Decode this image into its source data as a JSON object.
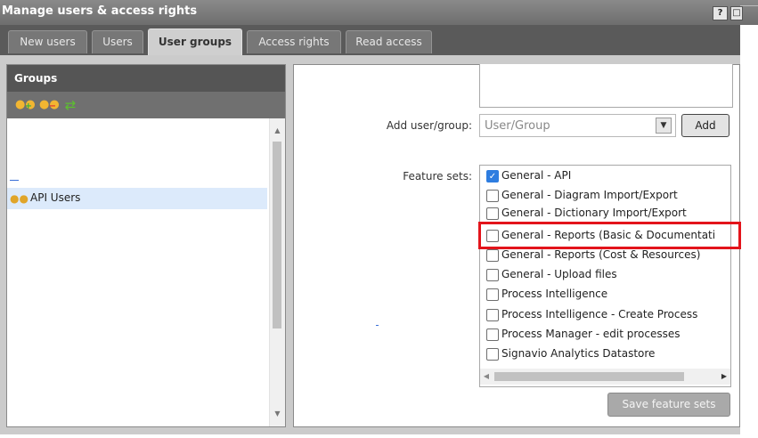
{
  "window": {
    "title": "Manage users & access rights",
    "help_label": "?",
    "close_label": "□"
  },
  "tabs": [
    {
      "label": "New users",
      "active": false
    },
    {
      "label": "Users",
      "active": false
    },
    {
      "label": "User groups",
      "active": true
    },
    {
      "label": "Access rights",
      "active": false
    },
    {
      "label": "Read access",
      "active": false
    }
  ],
  "groups": {
    "header": "Groups",
    "toolbar_icons": [
      "add-group-icon",
      "remove-group-icon",
      "refresh-icon"
    ],
    "items": [
      {
        "label": "API Users",
        "icon": "user-group-icon",
        "selected": true
      }
    ]
  },
  "form": {
    "add_user_group_label": "Add user/group:",
    "add_user_group_placeholder": "User/Group",
    "add_button": "Add",
    "feature_sets_label": "Feature sets:",
    "feature_sets": [
      {
        "label": "General - API",
        "checked": true
      },
      {
        "label": "General - Diagram Import/Export",
        "checked": false
      },
      {
        "label": "General - Dictionary Import/Export",
        "checked": false
      },
      {
        "label": "General - Reports (Basic & Documentati",
        "checked": false
      },
      {
        "label": "General - Reports (Cost & Resources)",
        "checked": false
      },
      {
        "label": "General - Upload files",
        "checked": false
      },
      {
        "label": "Process Intelligence",
        "checked": false
      },
      {
        "label": "Process Intelligence - Create Process",
        "checked": false
      },
      {
        "label": "Process Manager - edit processes",
        "checked": false
      },
      {
        "label": "Signavio Analytics Datastore",
        "checked": false
      }
    ],
    "save_button": "Save feature sets"
  },
  "colors": {
    "highlight": "#e3141b",
    "checkbox_checked": "#2e7de0",
    "selected_row": "#dceafb"
  }
}
